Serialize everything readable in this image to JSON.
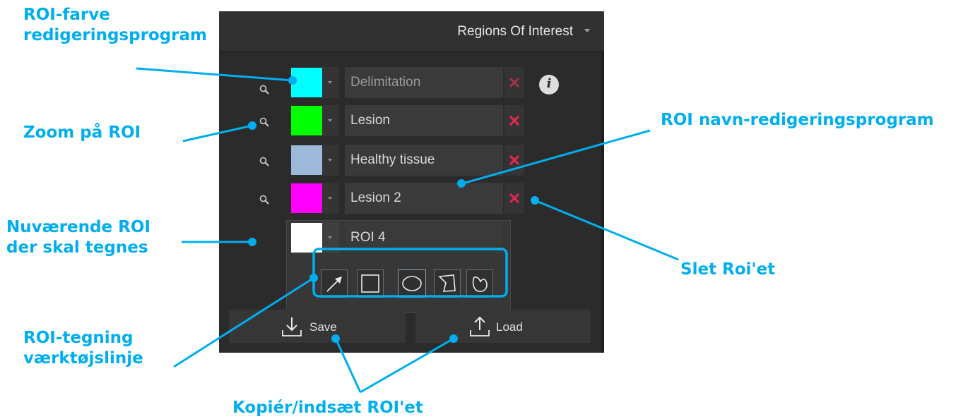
{
  "panel": {
    "title": "Regions Of Interest",
    "rois": [
      {
        "name": "Delimitation",
        "color": "#00ffff"
      },
      {
        "name": "Lesion",
        "color": "#00ff00"
      },
      {
        "name": "Healthy tissue",
        "color": "#9db8d9"
      },
      {
        "name": "Lesion 2",
        "color": "#ff00ff"
      }
    ],
    "current_roi": {
      "name": "ROI 4",
      "color": "#ffffff"
    },
    "info_glyph": "i",
    "tools": [
      "arrow-tool",
      "rectangle-tool",
      "ellipse-tool",
      "polygon-tool",
      "freehand-tool"
    ],
    "active_tool": "ellipse-tool",
    "save_label": "Save",
    "load_label": "Load",
    "delete_color": "#e8264f"
  },
  "annotations": {
    "color_editor_line1": "ROI-farve",
    "color_editor_line2": "redigeringsprogram",
    "zoom": "Zoom på ROI",
    "name_editor": "ROI navn-redigeringsprogram",
    "current_line1": "Nuværende ROI",
    "current_line2": "der skal tegnes",
    "delete": "Slet Roi'et",
    "toolbar_line1": "ROI-tegning",
    "toolbar_line2": "værktøjslinje",
    "copy_paste": "Kopiér/indsæt ROI'et"
  },
  "accent_color": "#00aeef"
}
